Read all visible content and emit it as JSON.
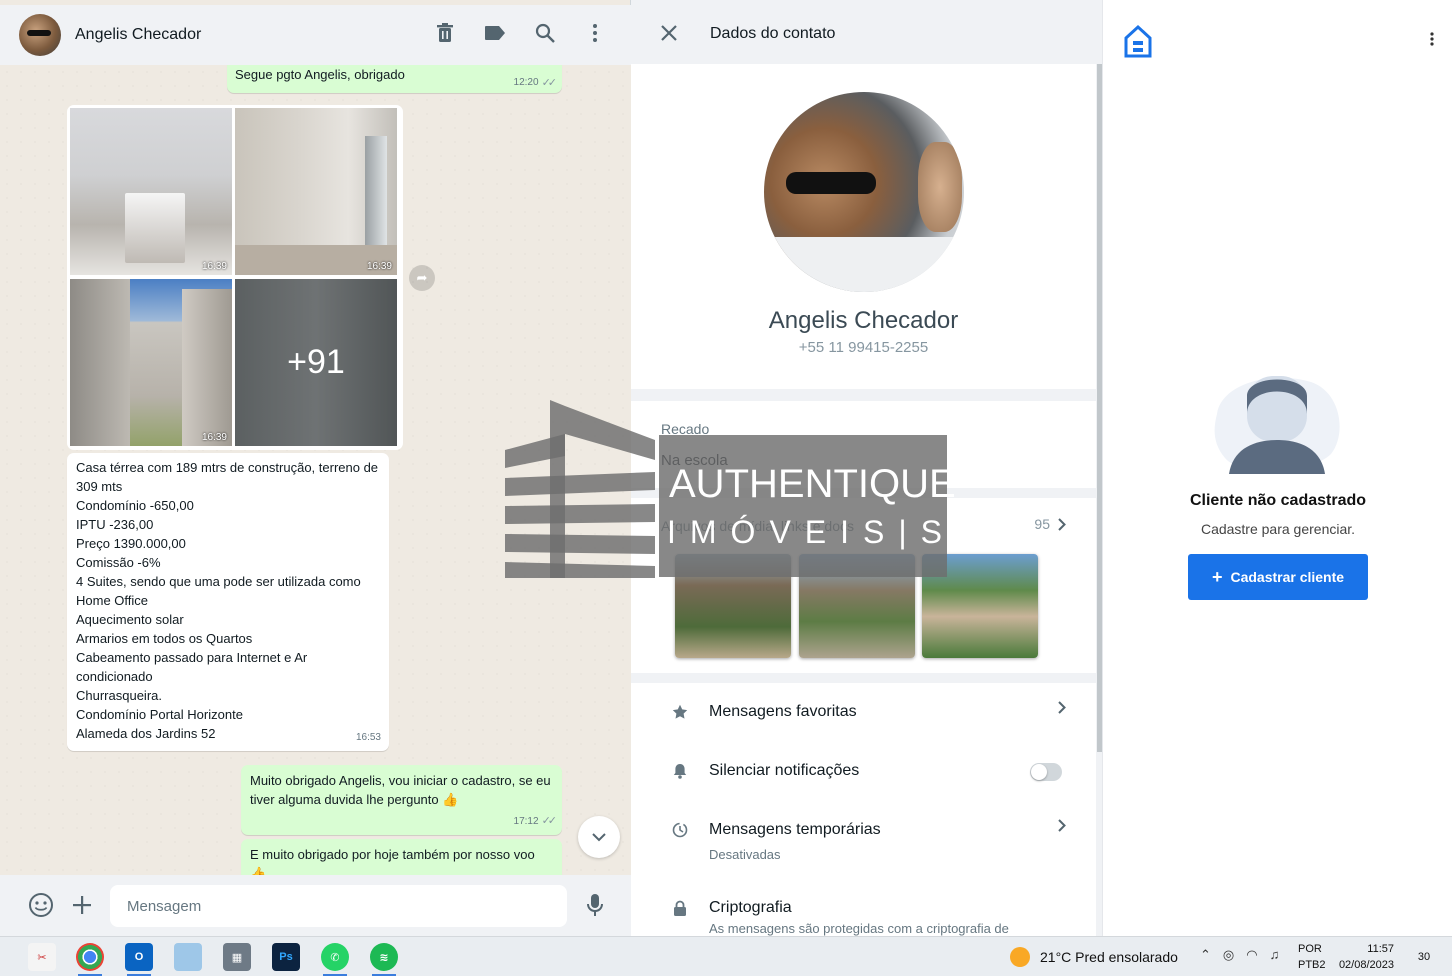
{
  "chat": {
    "header": {
      "name": "Angelis Checador"
    },
    "messages": {
      "m1": {
        "text": "Segue pgto Angelis, obrigado",
        "time": "12:20"
      },
      "album": {
        "t1": "16:39",
        "t2": "16:39",
        "t3": "16:39",
        "more": "+91"
      },
      "desc": {
        "text": "Casa térrea com 189 mtrs de construção, terreno de 309 mts\nCondomínio -650,00\nIPTU -236,00\nPreço 1390.000,00\nComissão -6%\n4 Suites, sendo que uma pode ser utilizada como Home Office\nAquecimento solar\nArmarios em todos os Quartos\nCabeamento passado para Internet e Ar condicionado\nChurrasqueira.\nCondomínio Portal Horizonte\nAlameda dos Jardins 52",
        "time": "16:53"
      },
      "m3": {
        "text": "Muito obrigado Angelis, vou iniciar o cadastro, se eu tiver alguma duvida lhe pergunto 👍",
        "time": "17:12"
      },
      "m4": {
        "text": "E muito obrigado por hoje também por nosso voo 👍"
      }
    },
    "composer": {
      "placeholder": "Mensagem"
    }
  },
  "contact": {
    "title": "Dados do contato",
    "name": "Angelis Checador",
    "phone": "+55 11 99415-2255",
    "about_label": "Recado",
    "about_value": "Na escola",
    "media_label": "Arquivos de mídia, links e docs",
    "media_count": "95",
    "rows": {
      "favorites": "Mensagens favoritas",
      "mute": "Silenciar notificações",
      "temp": "Mensagens temporárias",
      "temp_sub": "Desativadas",
      "crypto": "Criptografia",
      "crypto_sub": "As mensagens são protegidas com a criptografia de"
    }
  },
  "watermark": {
    "name": "AUTHENTIQUE",
    "sub": "IMÓVEIS|SP"
  },
  "crm": {
    "title": "Cliente não cadastrado",
    "subtitle": "Cadastre para gerenciar.",
    "button": "Cadastrar cliente"
  },
  "taskbar": {
    "weather": "21°C  Pred ensolarado",
    "lang1": "POR",
    "lang2": "PTB2",
    "time": "11:57",
    "date": "02/08/2023",
    "notifications": "30"
  }
}
